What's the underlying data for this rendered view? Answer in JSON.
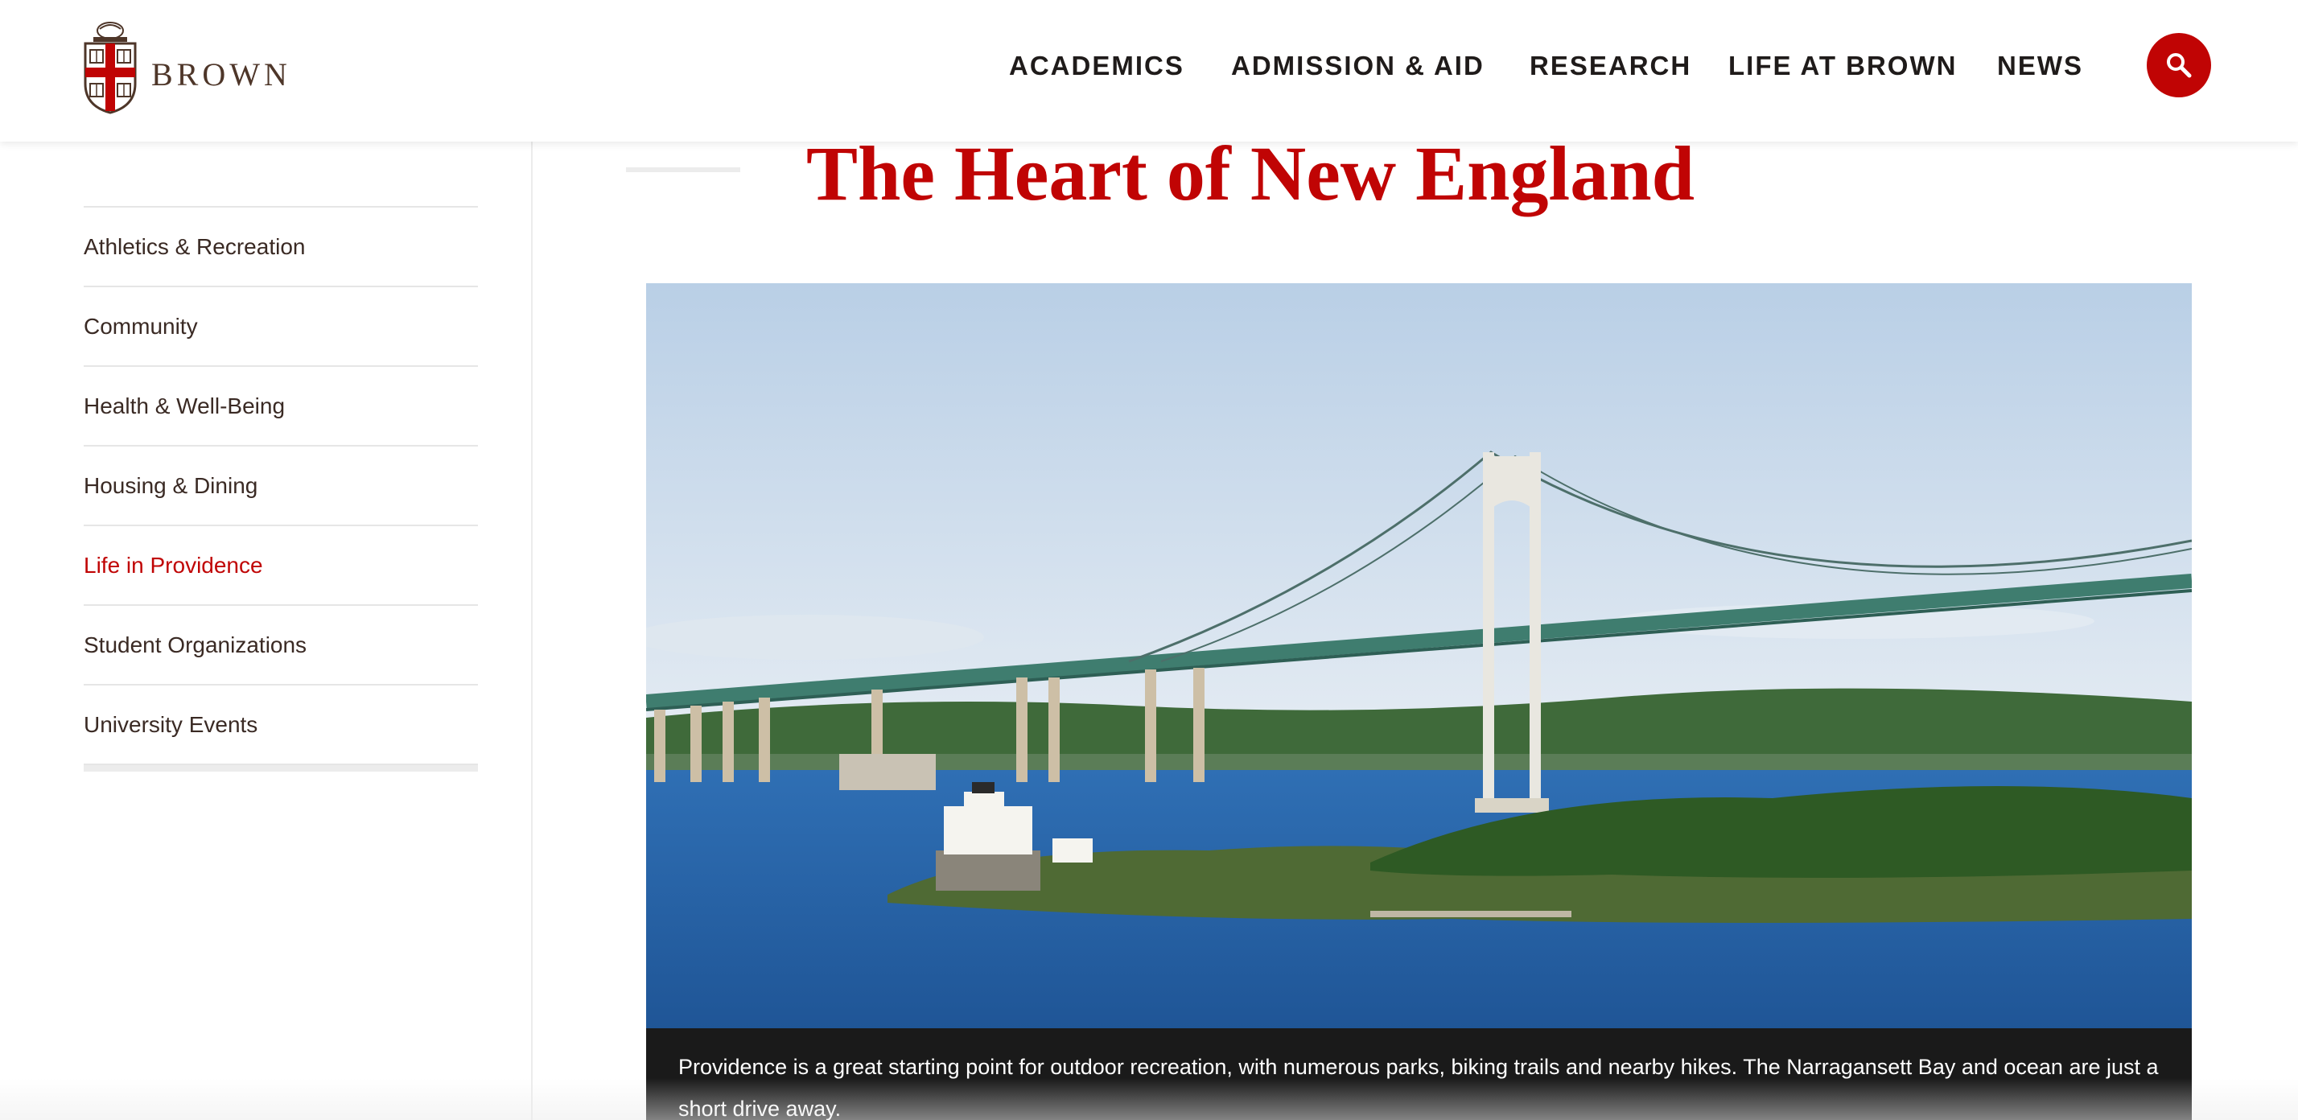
{
  "brand": {
    "name": "BROWN",
    "logo": "brown-university-shield"
  },
  "nav": {
    "items": [
      {
        "label": "ACADEMICS"
      },
      {
        "label": "ADMISSION & AID"
      },
      {
        "label": "RESEARCH"
      },
      {
        "label": "LIFE AT BROWN"
      },
      {
        "label": "NEWS"
      }
    ],
    "search_icon": "search-icon"
  },
  "sidebar": {
    "items": [
      {
        "label": "Athletics & Recreation",
        "active": false
      },
      {
        "label": "Community",
        "active": false
      },
      {
        "label": "Health & Well-Being",
        "active": false
      },
      {
        "label": "Housing & Dining",
        "active": false
      },
      {
        "label": "Life in Providence",
        "active": true
      },
      {
        "label": "Student Organizations",
        "active": false
      },
      {
        "label": "University Events",
        "active": false
      }
    ]
  },
  "main": {
    "title": "The Heart of New England",
    "hero_caption": "Providence is a great starting point for outdoor recreation, with numerous parks, biking trails and nearby hikes. The Narragansett Bay and ocean are just a short drive away."
  },
  "colors": {
    "brand_red": "#c00404",
    "text_brown": "#3a2a24",
    "caption_bg": "#1a1a1a"
  }
}
